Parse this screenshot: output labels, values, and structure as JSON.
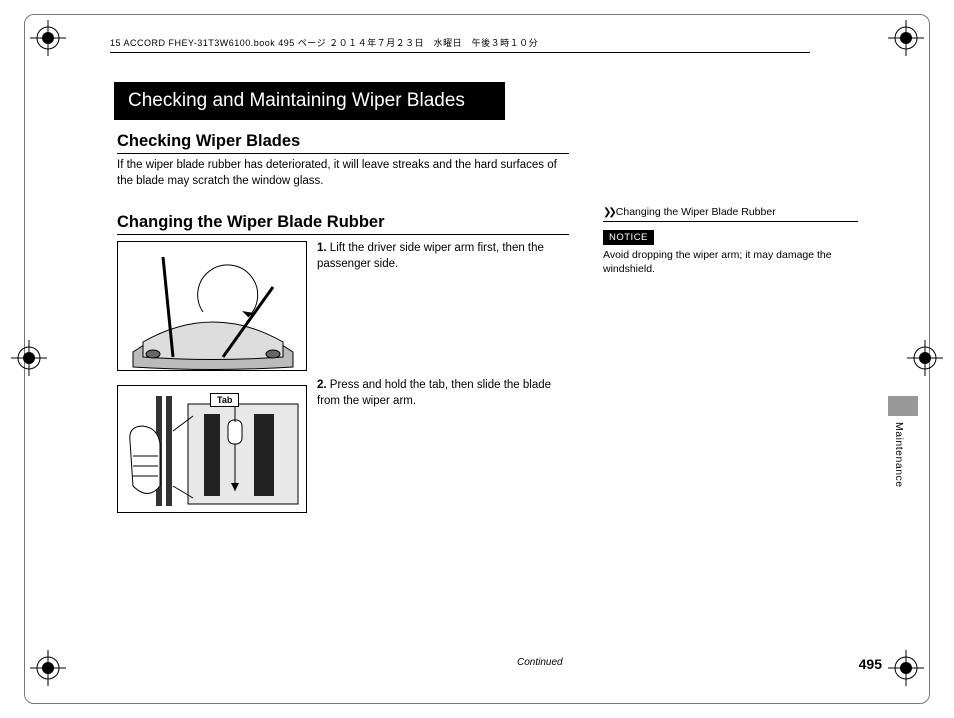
{
  "header": "15 ACCORD FHEY-31T3W6100.book  495 ページ  ２０１４年７月２３日　水曜日　午後３時１０分",
  "title": "Checking and Maintaining Wiper Blades",
  "sub1": "Checking Wiper Blades",
  "para1": "If the wiper blade rubber has deteriorated, it will leave streaks and the hard surfaces of the blade may scratch the window glass.",
  "sub2": "Changing the Wiper Blade Rubber",
  "step1_num": "1.",
  "step1": "Lift the driver side wiper arm first, then the passenger side.",
  "step2_num": "2.",
  "step2": "Press and hold the tab, then slide the blade from the wiper arm.",
  "tab_label": "Tab",
  "side_title": "Changing the Wiper Blade Rubber",
  "notice": "NOTICE",
  "side_text": "Avoid dropping the wiper arm; it may damage the windshield.",
  "continued": "Continued",
  "page_number": "495",
  "vtab_label": "Maintenance"
}
